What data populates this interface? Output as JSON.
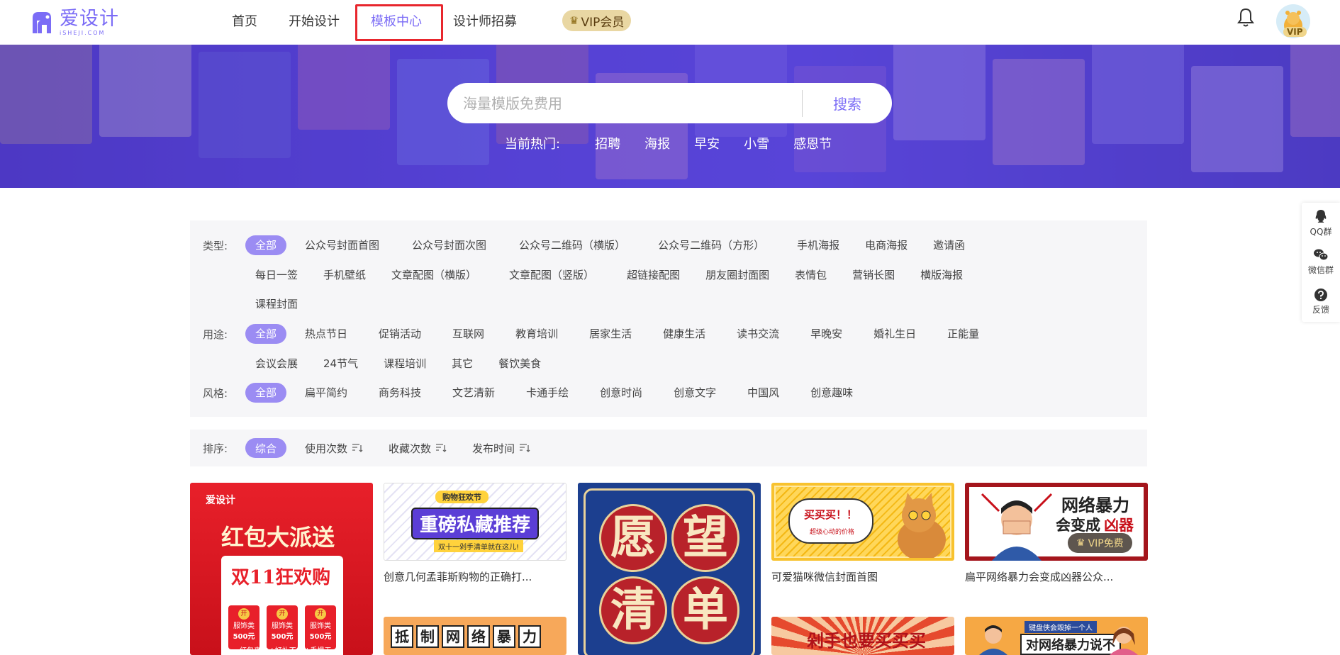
{
  "header": {
    "logo_cn": "爱设计",
    "logo_en": "iSHEJI.COM",
    "nav": [
      {
        "label": "首页"
      },
      {
        "label": "开始设计"
      },
      {
        "label": "模板中心"
      },
      {
        "label": "设计师招募"
      }
    ],
    "vip_label": "VIP会员",
    "avatar_badge": "VIP"
  },
  "banner": {
    "search_placeholder": "海量模版免费用",
    "search_button": "搜索",
    "hot_label": "当前热门:",
    "hot_items": [
      "招聘",
      "海报",
      "早安",
      "小雪",
      "感恩节"
    ]
  },
  "filters": {
    "type_label": "类型:",
    "type_row1": [
      "全部",
      "公众号封面首图",
      "公众号封面次图",
      "公众号二维码（横版）",
      "公众号二维码（方形）",
      "手机海报",
      "电商海报",
      "邀请函"
    ],
    "type_row2": [
      "每日一签",
      "手机壁纸",
      "文章配图（横版）",
      "文章配图（竖版）",
      "超链接配图",
      "朋友圈封面图",
      "表情包",
      "营销长图",
      "横版海报"
    ],
    "type_row3": [
      "课程封面"
    ],
    "use_label": "用途:",
    "use_row1": [
      "全部",
      "热点节日",
      "促销活动",
      "互联网",
      "教育培训",
      "居家生活",
      "健康生活",
      "读书交流",
      "早晚安",
      "婚礼生日",
      "正能量"
    ],
    "use_row2": [
      "会议会展",
      "24节气",
      "课程培训",
      "其它",
      "餐饮美食"
    ],
    "style_label": "风格:",
    "style_row": [
      "全部",
      "扁平简约",
      "商务科技",
      "文艺清新",
      "卡通手绘",
      "创意时尚",
      "创意文字",
      "中国风",
      "创意趣味"
    ]
  },
  "sort": {
    "label": "排序:",
    "items": [
      "综合",
      "使用次数",
      "收藏次数",
      "发布时间"
    ]
  },
  "cards": [
    {
      "caption": "",
      "poster_logo": "爱设计",
      "poster_title": "红包大派送",
      "poster_sub": "双11狂欢购",
      "coupon": "500元",
      "coupon_type": "服饰类",
      "coupon_open": "开",
      "footer": "红包来啦 / 好礼不停 / 手慢无"
    },
    {
      "caption": "创意几何孟菲斯购物的正确打...",
      "tag": "购物狂欢节",
      "title": "重磅私藏推荐",
      "sub": "双十一剁手清单就在这儿!"
    },
    {
      "caption": "",
      "chars": [
        "愿",
        "望",
        "清",
        "单"
      ]
    },
    {
      "caption": "可爱猫咪微信封面首图",
      "bubble": "买买买！！",
      "bubble_sub": "超级心动的价格"
    },
    {
      "caption": "扁平网络暴力会变成凶器公众...",
      "title1": "网络暴力",
      "title2": "会变成",
      "title3": "凶器",
      "vip_free": "VIP免费"
    },
    {
      "chars": [
        "抵",
        "制",
        "网",
        "络",
        "暴",
        "力"
      ]
    },
    {
      "title": "剁手也要买买买"
    },
    {
      "tag": "键盘侠会毁掉一个人",
      "title": "对网络暴力说不"
    }
  ],
  "side": [
    {
      "label": "QQ群",
      "icon": "qq-icon"
    },
    {
      "label": "微信群",
      "icon": "wechat-icon"
    },
    {
      "label": "反馈",
      "icon": "help-icon"
    }
  ],
  "colors": {
    "accent": "#7b6cf6",
    "chip_selected": "#9b8cf3",
    "highlight_border": "#e8262d"
  }
}
